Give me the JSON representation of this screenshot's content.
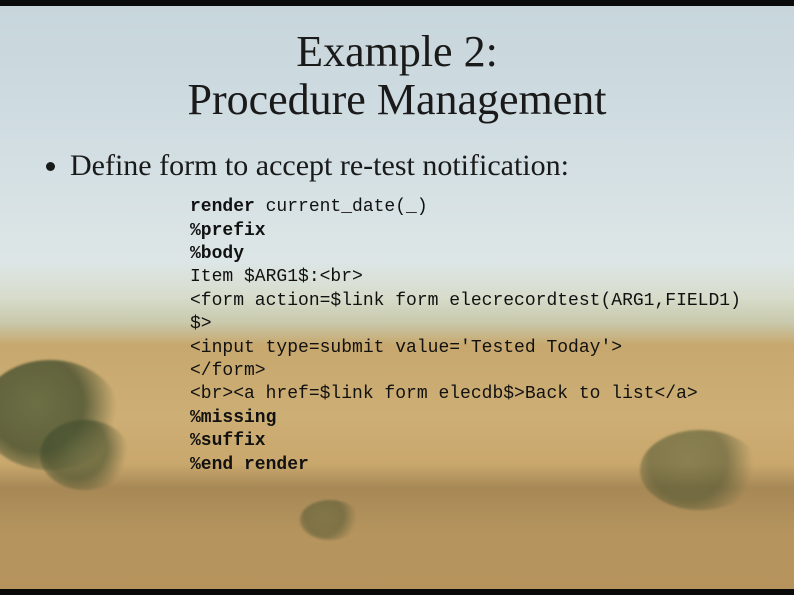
{
  "title_line1": "Example 2:",
  "title_line2": "Procedure Management",
  "bullet1": "Define form to accept re-test notification:",
  "code": {
    "l01a": "render",
    "l01b": " current_date(_)",
    "l02": "%prefix",
    "l03": "%body",
    "l04": "Item $ARG1$:<br>",
    "l05": "<form action=$link form elecrecordtest(ARG1,FIELD1) $>",
    "l06": "<input type=submit value='Tested Today'>",
    "l07": "</form>",
    "l08": "<br><a href=$link form elecdb$>Back to list</a>",
    "l09": "%missing",
    "l10": "%suffix",
    "l11": "%end render"
  }
}
